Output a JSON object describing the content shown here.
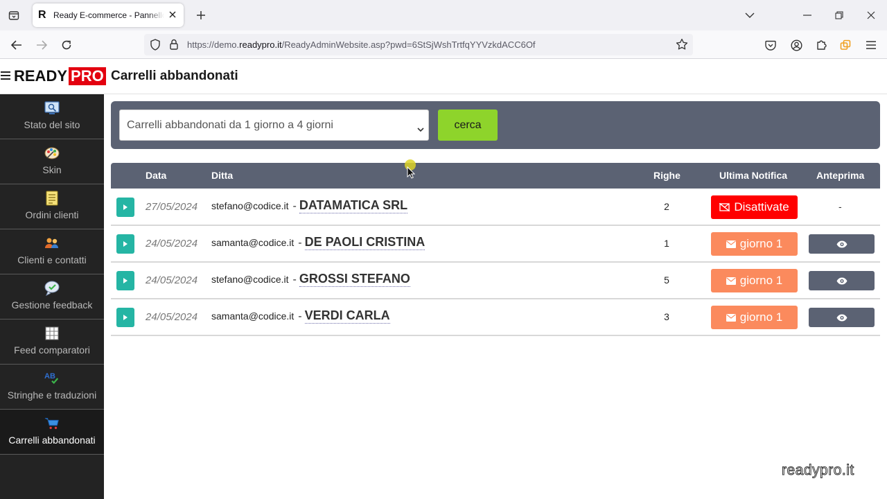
{
  "browser": {
    "tab_title": "Ready E-commerce - Pannello di amministrazione",
    "tab_favicon": "R",
    "url_prefix": "https://demo.",
    "url_domain": "readypro.it",
    "url_suffix": "/ReadyAdminWebsite.asp?pwd=6StSjWshTrtfqYYVzkdACC6Of"
  },
  "header": {
    "logo_ready": "READY",
    "logo_pro": "PRO",
    "page_title": "Carrelli abbandonati"
  },
  "sidebar": {
    "items": [
      {
        "label": "Stato del sito",
        "icon": "site-status-icon"
      },
      {
        "label": "Skin",
        "icon": "palette-icon"
      },
      {
        "label": "Ordini clienti",
        "icon": "orders-icon"
      },
      {
        "label": "Clienti e contatti",
        "icon": "contacts-icon"
      },
      {
        "label": "Gestione feedback",
        "icon": "feedback-icon"
      },
      {
        "label": "Feed comparatori",
        "icon": "grid-icon"
      },
      {
        "label": "Stringhe e traduzioni",
        "icon": "translation-icon"
      },
      {
        "label": "Carrelli abbandonati",
        "icon": "cart-icon",
        "active": true
      }
    ]
  },
  "filter": {
    "selected_option": "Carrelli abbandonati da 1 giorno a 4 giorni",
    "search_label": "cerca"
  },
  "table": {
    "columns": [
      "Data",
      "Ditta",
      "Righe",
      "Ultima Notifica",
      "Anteprima"
    ],
    "rows": [
      {
        "date": "27/05/2024",
        "email": "stefano@codice.it",
        "company": "DATAMATICA SRL",
        "righe": "2",
        "notifica": "Disattivate",
        "notifica_type": "off",
        "anteprima": "-"
      },
      {
        "date": "24/05/2024",
        "email": "samanta@codice.it",
        "company": "DE PAOLI CRISTINA",
        "righe": "1",
        "notifica": "giorno 1",
        "notifica_type": "day",
        "anteprima": "eye"
      },
      {
        "date": "24/05/2024",
        "email": "stefano@codice.it",
        "company": "GROSSI STEFANO",
        "righe": "5",
        "notifica": "giorno 1",
        "notifica_type": "day",
        "anteprima": "eye"
      },
      {
        "date": "24/05/2024",
        "email": "samanta@codice.it",
        "company": "VERDI CARLA",
        "righe": "3",
        "notifica": "giorno 1",
        "notifica_type": "day",
        "anteprima": "eye"
      }
    ]
  },
  "watermark": "readypro.it",
  "colors": {
    "accent_green": "#8ed42b",
    "header_slate": "#5b6273",
    "teal": "#25b5a4",
    "red": "#ff0000",
    "orange": "#fb8a5d",
    "sidebar_bg": "#232323"
  }
}
